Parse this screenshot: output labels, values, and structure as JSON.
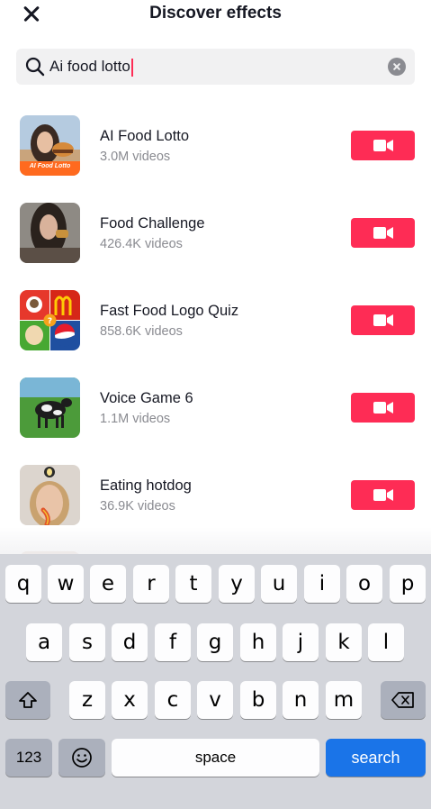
{
  "header": {
    "title": "Discover effects",
    "close_icon": "close-icon"
  },
  "search": {
    "query": "Ai food lotto",
    "icon": "search-icon",
    "clear_icon": "clear-icon"
  },
  "results": [
    {
      "name": "AI Food Lotto",
      "count": "3.0M videos",
      "thumb_caption": "AI Food Lotto"
    },
    {
      "name": "Food Challenge",
      "count": "426.4K videos"
    },
    {
      "name": "Fast Food Logo Quiz",
      "count": "858.6K videos"
    },
    {
      "name": "Voice Game 6",
      "count": "1.1M videos"
    },
    {
      "name": "Eating hotdog",
      "count": "36.9K videos"
    }
  ],
  "keyboard": {
    "row1": [
      "q",
      "w",
      "e",
      "r",
      "t",
      "y",
      "u",
      "i",
      "o",
      "p"
    ],
    "row2": [
      "a",
      "s",
      "d",
      "f",
      "g",
      "h",
      "j",
      "k",
      "l"
    ],
    "row3": [
      "z",
      "x",
      "c",
      "v",
      "b",
      "n",
      "m"
    ],
    "numbers_label": "123",
    "space_label": "space",
    "search_label": "search",
    "emoji_icon": "emoji-icon",
    "shift_icon": "shift-icon",
    "backspace_icon": "backspace-icon"
  },
  "colors": {
    "accent": "#fe2c55",
    "keyboard_bg": "#d3d5db",
    "search_key": "#1a74e8",
    "secondary_text": "#8a8b91"
  }
}
